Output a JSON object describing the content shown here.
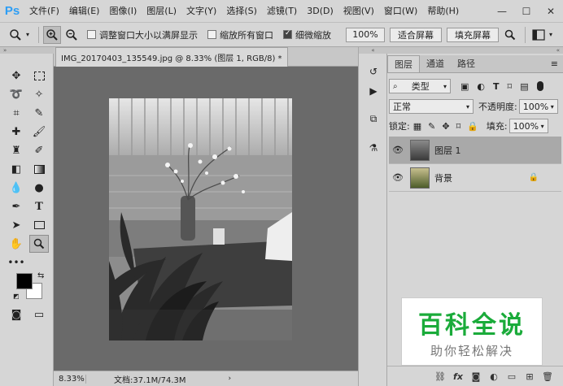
{
  "app": {
    "logo": "Ps"
  },
  "menu": [
    "文件(F)",
    "编辑(E)",
    "图像(I)",
    "图层(L)",
    "文字(Y)",
    "选择(S)",
    "滤镜(T)",
    "3D(D)",
    "视图(V)",
    "窗口(W)",
    "帮助(H)"
  ],
  "options": {
    "resize_windows": "调整窗口大小以满屏显示",
    "zoom_all": "缩放所有窗口",
    "scrubby_zoom": "细微缩放",
    "zoom_value": "100%",
    "fit_screen": "适合屏幕",
    "fill_screen": "填充屏幕"
  },
  "document": {
    "tab_title": "IMG_20170403_135549.jpg @ 8.33% (图层 1, RGB/8) *",
    "zoom": "8.33%",
    "doc_info": "文档:37.1M/74.3M"
  },
  "layers_panel": {
    "tabs": [
      "图层",
      "通道",
      "路径"
    ],
    "filter_kind": "类型",
    "blend_mode": "正常",
    "opacity_label": "不透明度:",
    "opacity_value": "100%",
    "lock_label": "锁定:",
    "fill_label": "填充:",
    "fill_value": "100%",
    "layers": [
      {
        "name": "图层 1",
        "selected": true
      },
      {
        "name": "背景",
        "locked": true
      }
    ]
  },
  "watermark": {
    "title": "百科全说",
    "subtitle": "助你轻松解决"
  },
  "colors": {
    "ps_blue": "#2d9ef5",
    "watermark_green": "#1aab3a"
  }
}
